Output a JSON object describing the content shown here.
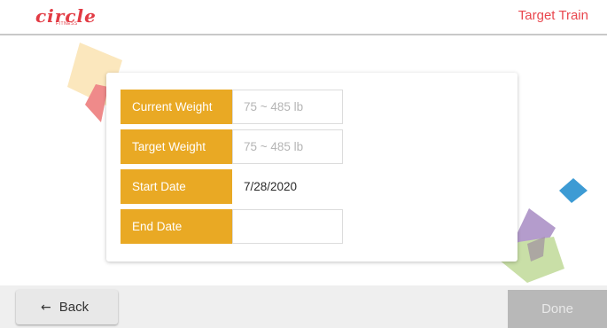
{
  "header": {
    "logo_text": "circle",
    "logo_sub": "FITNESS",
    "title": "Target Train"
  },
  "form": {
    "rows": [
      {
        "label": "Current Weight",
        "value": "",
        "placeholder": "75 ~ 485 lb"
      },
      {
        "label": "Target Weight",
        "value": "",
        "placeholder": "75 ~ 485 lb"
      },
      {
        "label": "Start Date",
        "value": "7/28/2020",
        "placeholder": ""
      },
      {
        "label": "End Date",
        "value": "",
        "placeholder": ""
      }
    ]
  },
  "footer": {
    "back_label": "Back",
    "back_icon": "left-arrow-icon",
    "done_label": "Done"
  },
  "colors": {
    "brand": "#e23b44",
    "label_bg": "#e9a924",
    "done_disabled": "#b8b8b8"
  }
}
